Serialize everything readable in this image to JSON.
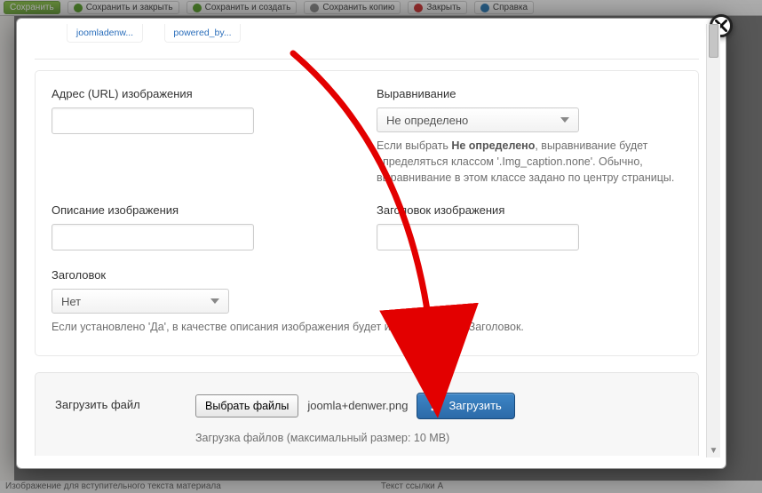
{
  "bg": {
    "save": "Сохранить",
    "save_close": "Сохранить и закрыть",
    "save_new": "Сохранить и создать",
    "save_copy": "Сохранить копию",
    "close": "Закрыть",
    "help": "Справка",
    "bottom_left": "Изображение для вступительного текста материала",
    "bottom_right": "Текст ссылки A"
  },
  "thumbs": {
    "a": "joomladenw...",
    "b": "powered_by..."
  },
  "form": {
    "url_label": "Адрес (URL) изображения",
    "align_label": "Выравнивание",
    "align_value": "Не определено",
    "align_hint_a": "Если выбрать ",
    "align_hint_b": "Не определено",
    "align_hint_c": ", выравнивание будет определяться классом '.Img_caption.none'. Обычно, выравнивание в этом классе задано по центру страницы.",
    "desc_label": "Описание изображения",
    "imgtitle_label": "Заголовок изображения",
    "head_label": "Заголовок",
    "head_value": "Нет",
    "head_hint": "Если установлено 'Да', в качестве описания изображения будет использоваться Заголовок."
  },
  "upload": {
    "label": "Загрузить файл",
    "choose": "Выбрать файлы",
    "filename": "joomla+denwer.png",
    "button": "Загрузить",
    "hint": "Загрузка файлов (максимальный размер: 10 MB)"
  }
}
